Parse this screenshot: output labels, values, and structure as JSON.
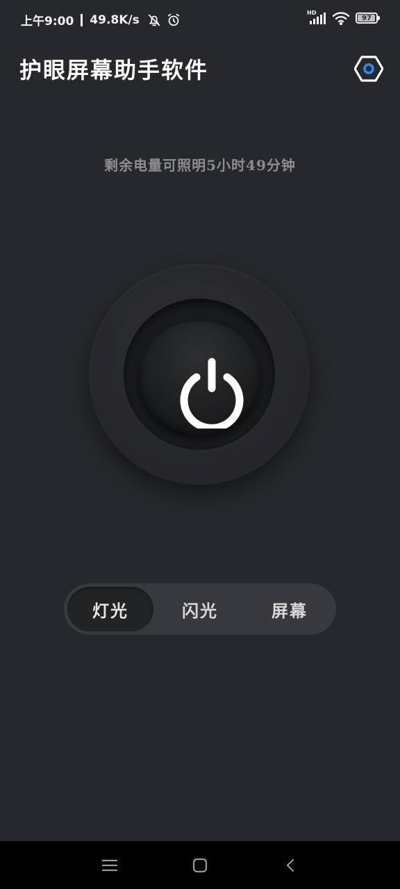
{
  "status_bar": {
    "time": "上午9:00",
    "net_speed": "49.8K/s",
    "mute_icon": "bell-off-icon",
    "alarm_icon": "alarm-icon",
    "signal_label": "HD",
    "signal_icon": "cell-signal-icon",
    "wifi_icon": "wifi-icon",
    "battery_level": "97"
  },
  "header": {
    "title": "护眼屏幕助手软件",
    "settings_icon": "hexagon-settings-icon",
    "accent_color": "#2e8bff"
  },
  "battery_remaining": "剩余电量可照明5小时49分钟",
  "power_button": {
    "icon": "power-icon",
    "icon_color": "#ffffff"
  },
  "modes": {
    "tabs": [
      {
        "label": "灯光",
        "active": true
      },
      {
        "label": "闪光",
        "active": false
      },
      {
        "label": "屏幕",
        "active": false
      }
    ]
  },
  "nav_bar": {
    "menu_icon": "menu-icon",
    "home_icon": "home-icon",
    "back_icon": "back-icon"
  },
  "colors": {
    "background": "#27282b",
    "secondary_text": "#8d8d8f",
    "tab_bar": "#38393c"
  }
}
